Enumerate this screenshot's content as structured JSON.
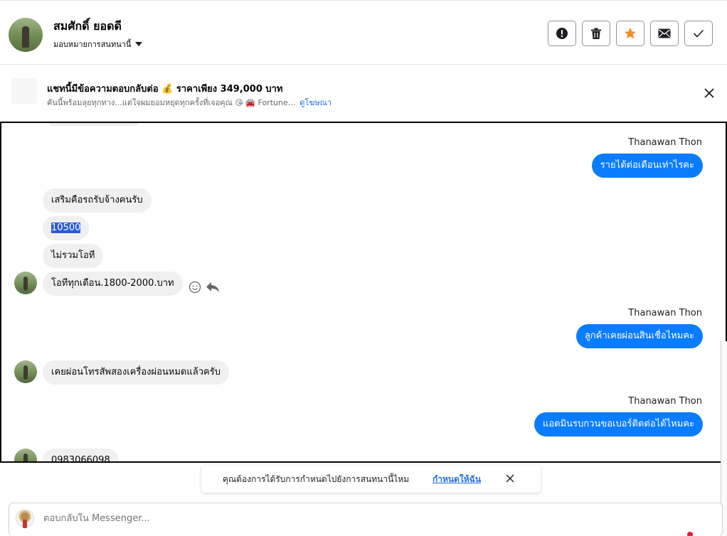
{
  "header": {
    "contact_name": "สมศักดิ์ ยอดดี",
    "assign_label": "มอบหมายการสนทนานี้",
    "actions": [
      "alert-icon",
      "trash-icon",
      "star-icon",
      "mail-icon",
      "check-icon"
    ],
    "star_color": "#f28c28"
  },
  "ad": {
    "title": "แชทนี้มีข้อความตอบกลับต่อ 💰 ราคาเพียง 349,000 บาท",
    "subtitle": "คันนี้พร้อมลุยทุกทาง...แต่ใจผมยอมหยุดทุกครั้งที่เจอคุณ 😘 🚘 Fortune...",
    "link": "ดูโฆษณา"
  },
  "chat": {
    "messages": [
      {
        "sender": "Thanawan Thon",
        "text": "รายได้ต่อเดือนเท่าไรคะ",
        "direction": "out"
      },
      {
        "text": "เสริมคือรถรับจ้างคนรับ",
        "direction": "in"
      },
      {
        "text": "10500",
        "direction": "in"
      },
      {
        "text": "ไม่รวมโอที",
        "direction": "in"
      },
      {
        "text": "โอทีทุกเดือน.1800-2000.บาท",
        "direction": "in"
      },
      {
        "sender": "Thanawan Thon",
        "text": "ลูกค้าเคยผ่อนสินเชื่อไหมคะ",
        "direction": "out"
      },
      {
        "text": "เคยผ่อนโทรสัพสองเครื่องผ่อนหมดแล้วครับ",
        "direction": "in"
      },
      {
        "sender": "Thanawan Thon",
        "text": "แอดมินรบกวนขอเบอร์ติดต่อได้ไหมคะ",
        "direction": "out"
      },
      {
        "text": "0983066098",
        "direction": "in"
      }
    ],
    "accent": "#0a7cff"
  },
  "notice": {
    "text": "คุณต้องการได้รับการกำหนดไปยังการสนทนานี้ไหม",
    "link": "กำหนดให้ฉัน"
  },
  "composer": {
    "placeholder": "ตอบกลับใน Messenger..."
  }
}
